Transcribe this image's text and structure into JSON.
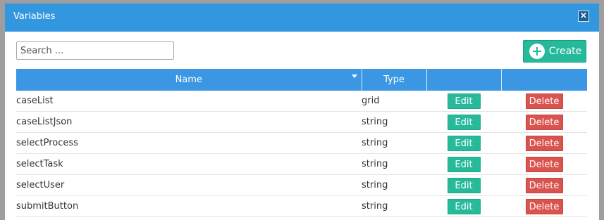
{
  "dialog": {
    "title": "Variables",
    "close_label": "×"
  },
  "search": {
    "placeholder": "Search ..."
  },
  "create": {
    "label": "Create",
    "icon": "plus-circle-icon"
  },
  "table": {
    "columns": [
      "Name",
      "Type",
      "",
      ""
    ],
    "rows": [
      {
        "name": "caseList",
        "type": "grid",
        "edit_label": "Edit",
        "delete_label": "Delete"
      },
      {
        "name": "caseListJson",
        "type": "string",
        "edit_label": "Edit",
        "delete_label": "Delete"
      },
      {
        "name": "selectProcess",
        "type": "string",
        "edit_label": "Edit",
        "delete_label": "Delete"
      },
      {
        "name": "selectTask",
        "type": "string",
        "edit_label": "Edit",
        "delete_label": "Delete"
      },
      {
        "name": "selectUser",
        "type": "string",
        "edit_label": "Edit",
        "delete_label": "Delete"
      },
      {
        "name": "submitButton",
        "type": "string",
        "edit_label": "Edit",
        "delete_label": "Delete"
      }
    ]
  },
  "colors": {
    "titlebar": "#3397e0",
    "header": "#3b97e3",
    "success": "#26b99a",
    "danger": "#d9534f"
  }
}
